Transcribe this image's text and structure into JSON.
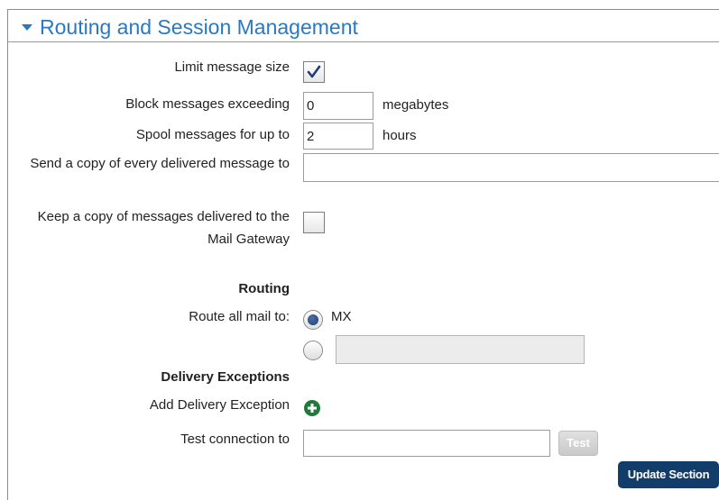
{
  "header": {
    "title": "Routing and Session Management"
  },
  "fields": {
    "limit_size": {
      "label": "Limit message size",
      "checked": true
    },
    "block_exceeding": {
      "label": "Block messages exceeding",
      "value": "0",
      "unit": "megabytes"
    },
    "spool": {
      "label": "Spool messages for up to",
      "value": "2",
      "unit": "hours"
    },
    "send_copy": {
      "label": "Send a copy of every delivered message to",
      "value": ""
    },
    "keep_copy": {
      "label": "Keep a copy of messages delivered to the Mail Gateway",
      "checked": false
    }
  },
  "routing": {
    "heading": "Routing",
    "route_label": "Route all mail to:",
    "option_mx": "MX",
    "option_custom_value": "",
    "selected": "MX"
  },
  "delivery_exceptions": {
    "heading": "Delivery Exceptions",
    "add_label": "Add Delivery Exception"
  },
  "test_connection": {
    "label": "Test connection to",
    "value": "",
    "button": "Test"
  },
  "update_button": "Update Section",
  "colors": {
    "title_blue": "#2b78c2",
    "update_button_bg": "#123d6b",
    "add_icon_green": "#1f7a3a",
    "radio_selected": "#1d3e73"
  }
}
